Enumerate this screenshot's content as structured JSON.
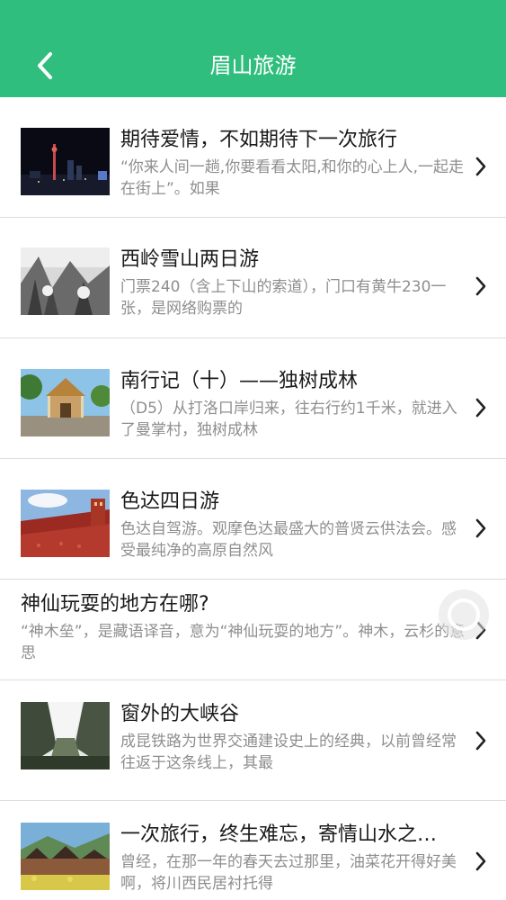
{
  "header": {
    "title": "眉山旅游",
    "background": "#2fbe7d",
    "back_icon": "chevron-left-icon"
  },
  "articles": [
    {
      "title": "期待爱情，不如期待下一次旅行",
      "desc": "“你来人间一趟,你要看看太阳,和你的心上人,一起走在街上”。如果",
      "thumb": "city-night-skyline"
    },
    {
      "title": "西岭雪山两日游",
      "desc": "门票240（含上下山的索道），门口有黄牛230一张，是网络购票的",
      "thumb": "snowy-forest"
    },
    {
      "title": "南行记（十）——独树成林",
      "desc": "（D5）从打洛口岸归来，往右行约1千米，就进入了曼掌村，独树成林",
      "thumb": "temple-gate"
    },
    {
      "title": "色达四日游",
      "desc": "色达自驾游。观摩色达最盛大的普贤云供法会。感受最纯净的高原自然风",
      "thumb": "red-houses-hillside"
    },
    {
      "title": "神仙玩耍的地方在哪?",
      "desc": "“神木垒”，是藏语译音，意为“神仙玩耍的地方”。神木，云杉的意思",
      "thumb": ""
    },
    {
      "title": "窗外的大峡谷",
      "desc": "成昆铁路为世界交通建设史上的经典，以前曾经常往返于这条线上，其最",
      "thumb": "canyon-valley"
    },
    {
      "title": "一次旅行，终生难忘，寄情山水之…",
      "desc": "曾经，在那一年的春天去过那里，油菜花开得好美啊，将川西民居衬托得",
      "thumb": "village-flowers"
    }
  ]
}
